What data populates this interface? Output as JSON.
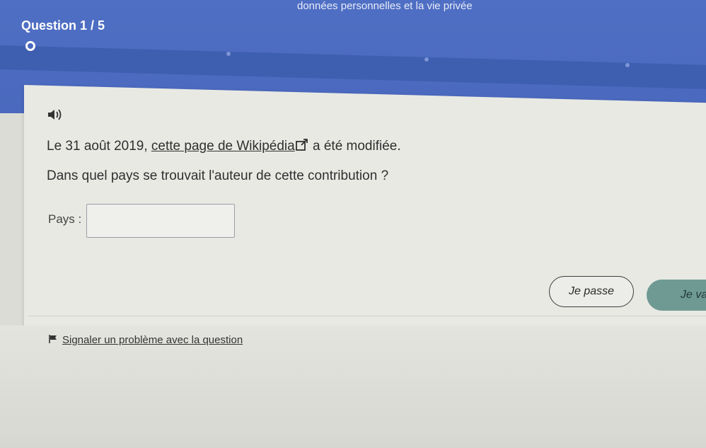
{
  "header": {
    "title": "données personnelles et la vie privée",
    "question_count": "Question 1 / 5"
  },
  "question": {
    "sentence_prefix": "Le 31 août 2019, ",
    "link_text": "cette page de Wikipédia",
    "sentence_suffix": " a été modifiée.",
    "prompt": "Dans quel pays se trouvait l'auteur de cette contribution ?"
  },
  "form": {
    "pays_label": "Pays :",
    "pays_value": ""
  },
  "buttons": {
    "skip_label": "Je passe",
    "validate_label": "Je va"
  },
  "report": {
    "label": "Signaler un problème avec la question"
  },
  "icons": {
    "audio": "speaker-icon",
    "external": "external-link-icon",
    "flag": "flag-icon"
  },
  "colors": {
    "header_blue": "#4a69be",
    "validate_green": "#6f9a93"
  }
}
